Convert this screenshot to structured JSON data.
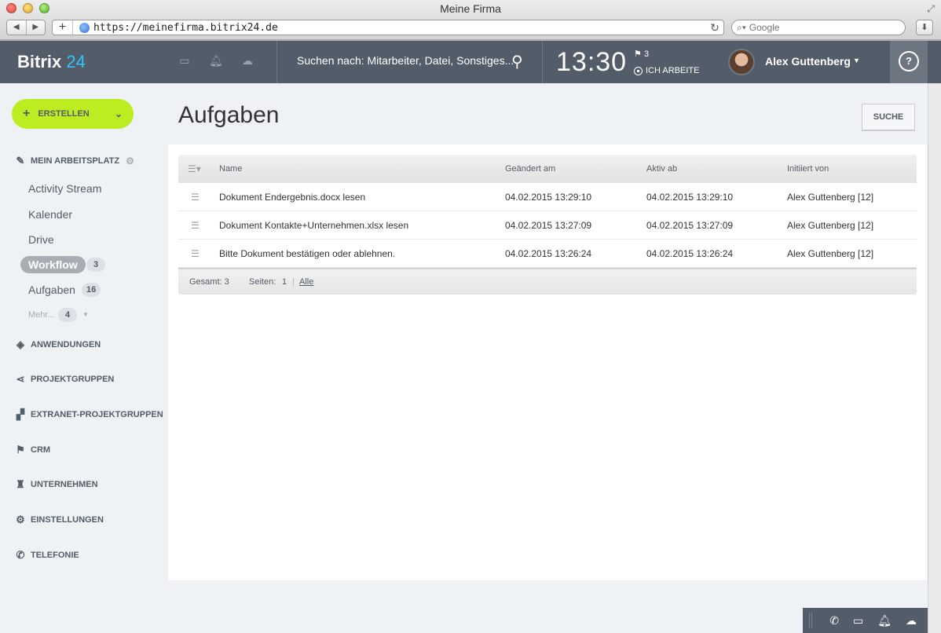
{
  "browser": {
    "window_title": "Meine Firma",
    "url": "https://meinefirma.bitrix24.de",
    "search_placeholder": "Google",
    "back_glyph": "◀",
    "forward_glyph": "▶",
    "plus_glyph": "+",
    "reload_glyph": "↻",
    "download_glyph": "⬇"
  },
  "header": {
    "logo_text": "Bitrix",
    "logo_number": "24",
    "logo_accent": "#2fc6f6",
    "search_text": "Suchen nach: Mitarbeiter, Datei, Sonstiges...",
    "time": "13:30",
    "flag_count": "3",
    "status": "ICH ARBEITE",
    "user_name": "Alex Guttenberg",
    "help": "?",
    "icons": [
      "chat-icon",
      "bell-icon",
      "cloud-icon"
    ],
    "bg": "#535c69"
  },
  "sidebar": {
    "create_label": "ERSTELLEN",
    "create_color": "#bbed21",
    "workplace": "MEIN ARBEITSPLATZ",
    "items": [
      {
        "label": "Activity Stream"
      },
      {
        "label": "Kalender"
      },
      {
        "label": "Drive"
      },
      {
        "label": "Workflow",
        "count": "3",
        "active": true
      },
      {
        "label": "Aufgaben",
        "count": "16"
      }
    ],
    "more_label": "Mehr...",
    "more_count": "4",
    "sections": [
      {
        "label": "ANWENDUNGEN",
        "icon": "cube-icon"
      },
      {
        "label": "PROJEKTGRUPPEN",
        "icon": "share-icon"
      },
      {
        "label": "EXTRANET-PROJEKTGRUPPEN",
        "icon": "blocks-icon"
      },
      {
        "label": "CRM",
        "icon": "flag-icon"
      },
      {
        "label": "UNTERNEHMEN",
        "icon": "castle-icon"
      },
      {
        "label": "EINSTELLUNGEN",
        "icon": "gear-icon"
      },
      {
        "label": "TELEFONIE",
        "icon": "phone-icon"
      }
    ]
  },
  "main": {
    "title": "Aufgaben",
    "search_button": "SUCHE",
    "columns": [
      "Name",
      "Geändert am",
      "Aktiv ab",
      "Initiiert von"
    ],
    "rows": [
      {
        "name": "Dokument Endergebnis.docx lesen",
        "changed": "04.02.2015 13:29:10",
        "active": "04.02.2015 13:29:10",
        "by": "Alex Guttenberg [12]"
      },
      {
        "name": "Dokument Kontakte+Unternehmen.xlsx lesen",
        "changed": "04.02.2015 13:27:09",
        "active": "04.02.2015 13:27:09",
        "by": "Alex Guttenberg [12]"
      },
      {
        "name": "Bitte Dokument bestätigen oder ablehnen.",
        "changed": "04.02.2015 13:26:24",
        "active": "04.02.2015 13:26:24",
        "by": "Alex Guttenberg [12]"
      }
    ],
    "footer": {
      "total_label": "Gesamt: 3",
      "pages_label": "Seiten:",
      "page": "1",
      "all_label": "Alle"
    }
  }
}
